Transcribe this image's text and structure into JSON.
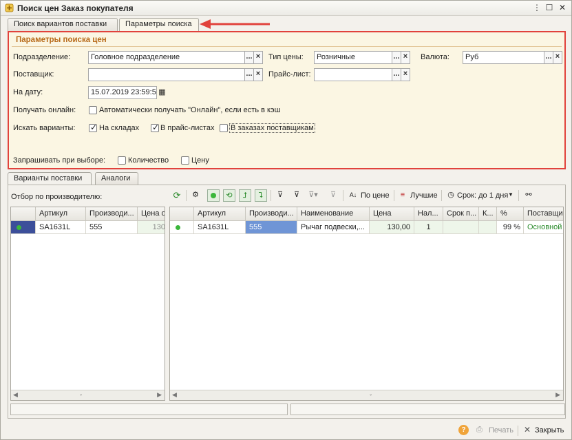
{
  "window": {
    "title": "Поиск цен Заказ покупателя"
  },
  "top_tabs": [
    {
      "label": "Поиск вариантов поставки",
      "active": false
    },
    {
      "label": "Параметры поиска",
      "active": true
    }
  ],
  "params": {
    "title": "Параметры поиска цен",
    "division": {
      "label": "Подразделение:",
      "value": "Головное подразделение"
    },
    "price_type": {
      "label": "Тип цены:",
      "value": "Розничные"
    },
    "currency": {
      "label": "Валюта:",
      "value": "Руб"
    },
    "supplier": {
      "label": "Поставщик:",
      "value": ""
    },
    "price_list": {
      "label": "Прайс-лист:",
      "value": ""
    },
    "date": {
      "label": "На дату:",
      "value": "15.07.2019 23:59:5"
    },
    "online": {
      "label": "Получать онлайн:",
      "option": "Автоматически получать \"Онлайн\", если есть в кэш",
      "checked": false
    },
    "search_variants": {
      "label": "Искать варианты:",
      "in_stock": {
        "label": "На складах",
        "checked": true
      },
      "in_price_lists": {
        "label": "В прайс-листах",
        "checked": true
      },
      "in_supplier_orders": {
        "label": "В заказах поставщикам",
        "checked": false
      }
    },
    "ask_on_select": {
      "label": "Запрашивать при выборе:",
      "quantity": {
        "label": "Количество",
        "checked": false
      },
      "price": {
        "label": "Цену",
        "checked": false
      }
    },
    "select_btn": "...",
    "clear_btn": "×"
  },
  "bottom_tabs": [
    {
      "label": "Варианты поставки",
      "active": true
    },
    {
      "label": "Аналоги",
      "active": false
    }
  ],
  "filter_label": "Отбор по производителю:",
  "toolbar": {
    "by_price": "По цене",
    "best": "Лучшие",
    "term": "Срок: до 1 дня",
    "icons": [
      "refresh-icon",
      "settings-icon",
      "green-dot-icon",
      "circle-arrows-icon",
      "sort-up-icon",
      "sort-down-icon",
      "filter-icon",
      "filter-clear-icon",
      "filter-dropdown-icon",
      "filter-off-icon",
      "sort-az-icon",
      "best-list-icon",
      "clock-icon",
      "binoculars-icon"
    ]
  },
  "left_grid": {
    "columns": [
      "Артикул",
      "Производи...",
      "Цена о"
    ],
    "rows": [
      {
        "article": "SA1631L",
        "manufacturer": "555",
        "price": "130"
      }
    ]
  },
  "right_grid": {
    "columns": [
      "Артикул",
      "Производи...",
      "Наименование",
      "Цена",
      "Нал...",
      "Срок п...",
      "К...",
      "%",
      "Поставщик"
    ],
    "rows": [
      {
        "article": "SA1631L",
        "manufacturer": "555",
        "name": "Рычаг подвески,...",
        "price": "130,00",
        "stock": "1",
        "term": "",
        "k": "",
        "percent": "99 %",
        "supplier": "Основной с"
      }
    ]
  },
  "footer": {
    "print": "Печать",
    "close": "Закрыть",
    "help": "?"
  },
  "colors": {
    "accent_border": "#e1423c",
    "panel_bg": "#fbf6e3",
    "selected_cell": "#6f95d6"
  }
}
